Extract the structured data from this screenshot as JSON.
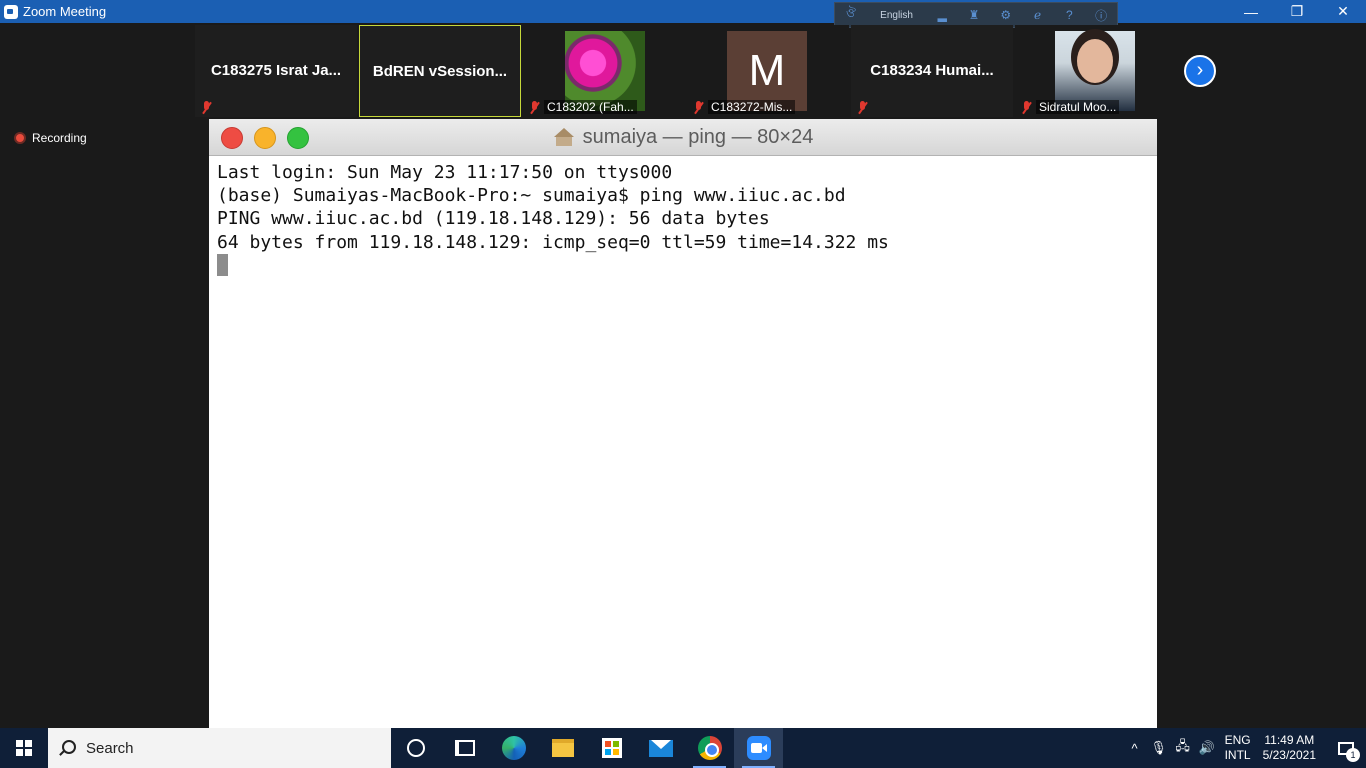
{
  "window": {
    "title": "Zoom Meeting",
    "controls": {
      "minimize": "—",
      "restore": "❐",
      "close": "✕"
    }
  },
  "language_bar": {
    "language": "English"
  },
  "video_strip": {
    "tiles": [
      {
        "name": "C183275 Israt Ja...",
        "muted": true,
        "type": "name-only"
      },
      {
        "name": "BdREN  vSession...",
        "muted": false,
        "type": "name-only",
        "active": true
      },
      {
        "name": "C183202 (Fah...",
        "muted": true,
        "type": "photo",
        "photo": "flower"
      },
      {
        "name": "C183272-Mis...",
        "muted": true,
        "type": "avatar",
        "avatar_letter": "M"
      },
      {
        "name": "C183234  Humai...",
        "muted": true,
        "type": "name-only"
      },
      {
        "name": "Sidratul Moo...",
        "muted": true,
        "type": "photo",
        "photo": "person"
      }
    ],
    "next_icon": "›"
  },
  "recording": {
    "label": "Recording"
  },
  "terminal": {
    "title": "sumaiya — ping — 80×24",
    "lines": [
      "Last login: Sun May 23 11:17:50 on ttys000",
      "(base) Sumaiyas-MacBook-Pro:~ sumaiya$ ping www.iiuc.ac.bd",
      "PING www.iiuc.ac.bd (119.18.148.129): 56 data bytes",
      "64 bytes from 119.18.148.129: icmp_seq=0 ttl=59 time=14.322 ms"
    ]
  },
  "taskbar": {
    "search_placeholder": "Search",
    "apps": [
      "cortana",
      "task-view",
      "edge",
      "file-explorer",
      "store",
      "mail",
      "chrome",
      "zoom"
    ],
    "tray": {
      "language_top": "ENG",
      "language_bottom": "INTL",
      "time": "11:49 AM",
      "date": "5/23/2021",
      "notification_count": "1"
    }
  },
  "colors": {
    "zoom_titlebar": "#1b5fb3",
    "taskbar": "#0f1f38",
    "active_speaker_border": "#c6d83a",
    "muted_red": "#e0382f"
  }
}
